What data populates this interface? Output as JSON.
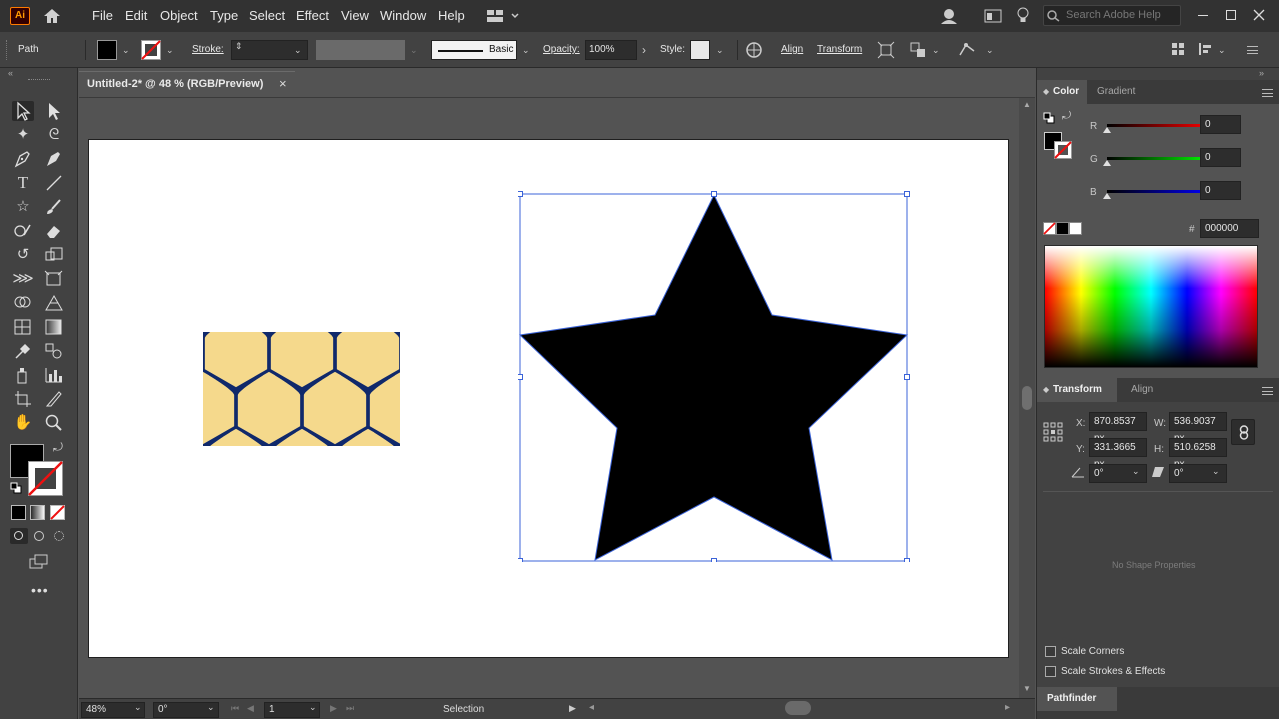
{
  "app": {
    "logo": "Ai"
  },
  "menu": {
    "items": [
      "File",
      "Edit",
      "Object",
      "Type",
      "Select",
      "Effect",
      "View",
      "Window",
      "Help"
    ],
    "search_placeholder": "Search Adobe Help"
  },
  "control": {
    "selection_type": "Path",
    "stroke_label": "Stroke:",
    "stroke_profile": "Basic",
    "opacity_label": "Opacity:",
    "opacity_value": "100%",
    "style_label": "Style:",
    "align_label": "Align",
    "transform_label": "Transform"
  },
  "document": {
    "tab_title": "Untitled-2* @ 48 % (RGB/Preview)",
    "close_glyph": "×"
  },
  "status": {
    "zoom": "48%",
    "rotation": "0°",
    "artboard_number": "1",
    "tool_name": "Selection"
  },
  "color_panel": {
    "tabs": [
      "Color",
      "Gradient"
    ],
    "r_label": "R",
    "r_value": "0",
    "g_label": "G",
    "g_value": "0",
    "b_label": "B",
    "b_value": "0",
    "hex_label": "#",
    "hex_value": "000000"
  },
  "transform_panel": {
    "tabs": [
      "Transform",
      "Align"
    ],
    "x_label": "X:",
    "x_value": "870.8537 px",
    "y_label": "Y:",
    "y_value": "331.3665 px",
    "w_label": "W:",
    "w_value": "536.9037 px",
    "h_label": "H:",
    "h_value": "510.6258 px",
    "rotate_value": "0°",
    "shear_value": "0°",
    "no_shape": "No Shape Properties",
    "scale_corners": "Scale Corners",
    "scale_strokes": "Scale Strokes & Effects"
  },
  "pathfinder": {
    "label": "Pathfinder"
  },
  "colors": {
    "pattern_navy": "#10296b",
    "pattern_gold": "#f5d98c",
    "selection_blue": "#3b63d8",
    "fill_black": "#000000"
  }
}
